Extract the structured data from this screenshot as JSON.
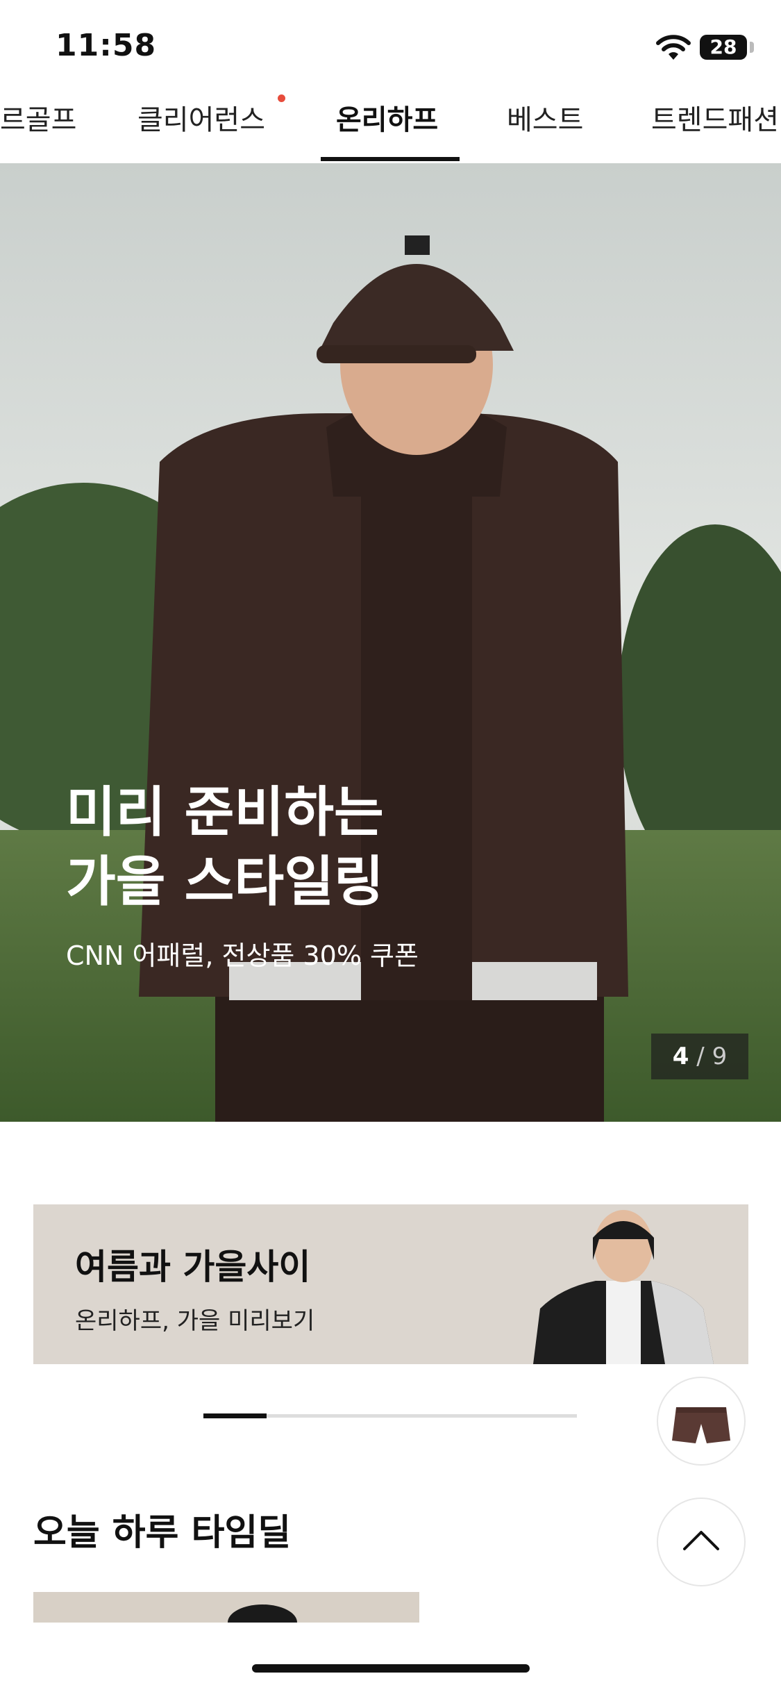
{
  "status_bar": {
    "time": "11:58",
    "battery": "28"
  },
  "tabs": [
    {
      "label": "르골프"
    },
    {
      "label": "클리어런스"
    },
    {
      "label": "온리하프"
    },
    {
      "label": "베스트"
    },
    {
      "label": "트렌드패션"
    }
  ],
  "hero": {
    "title": "미리 준비하는\n가을 스타일링",
    "subtitle": "CNN 어패럴,  전상품 30% 쿠폰",
    "counter_current": "4",
    "counter_separator": "/",
    "counter_total": "9"
  },
  "promo_banner": {
    "title": "여름과 가을사이",
    "subtitle": "온리하프, 가을 미리보기"
  },
  "carousel_progress": 0.17,
  "section": {
    "title": "오늘 하루 타임딜"
  },
  "colors": {
    "accent": "#111111",
    "notification_dot": "#e74c3c",
    "promo_bg": "#dcd6cf"
  },
  "icons": [
    "wifi-icon",
    "battery-icon",
    "shorts-thumbnail",
    "chevron-up-icon"
  ]
}
